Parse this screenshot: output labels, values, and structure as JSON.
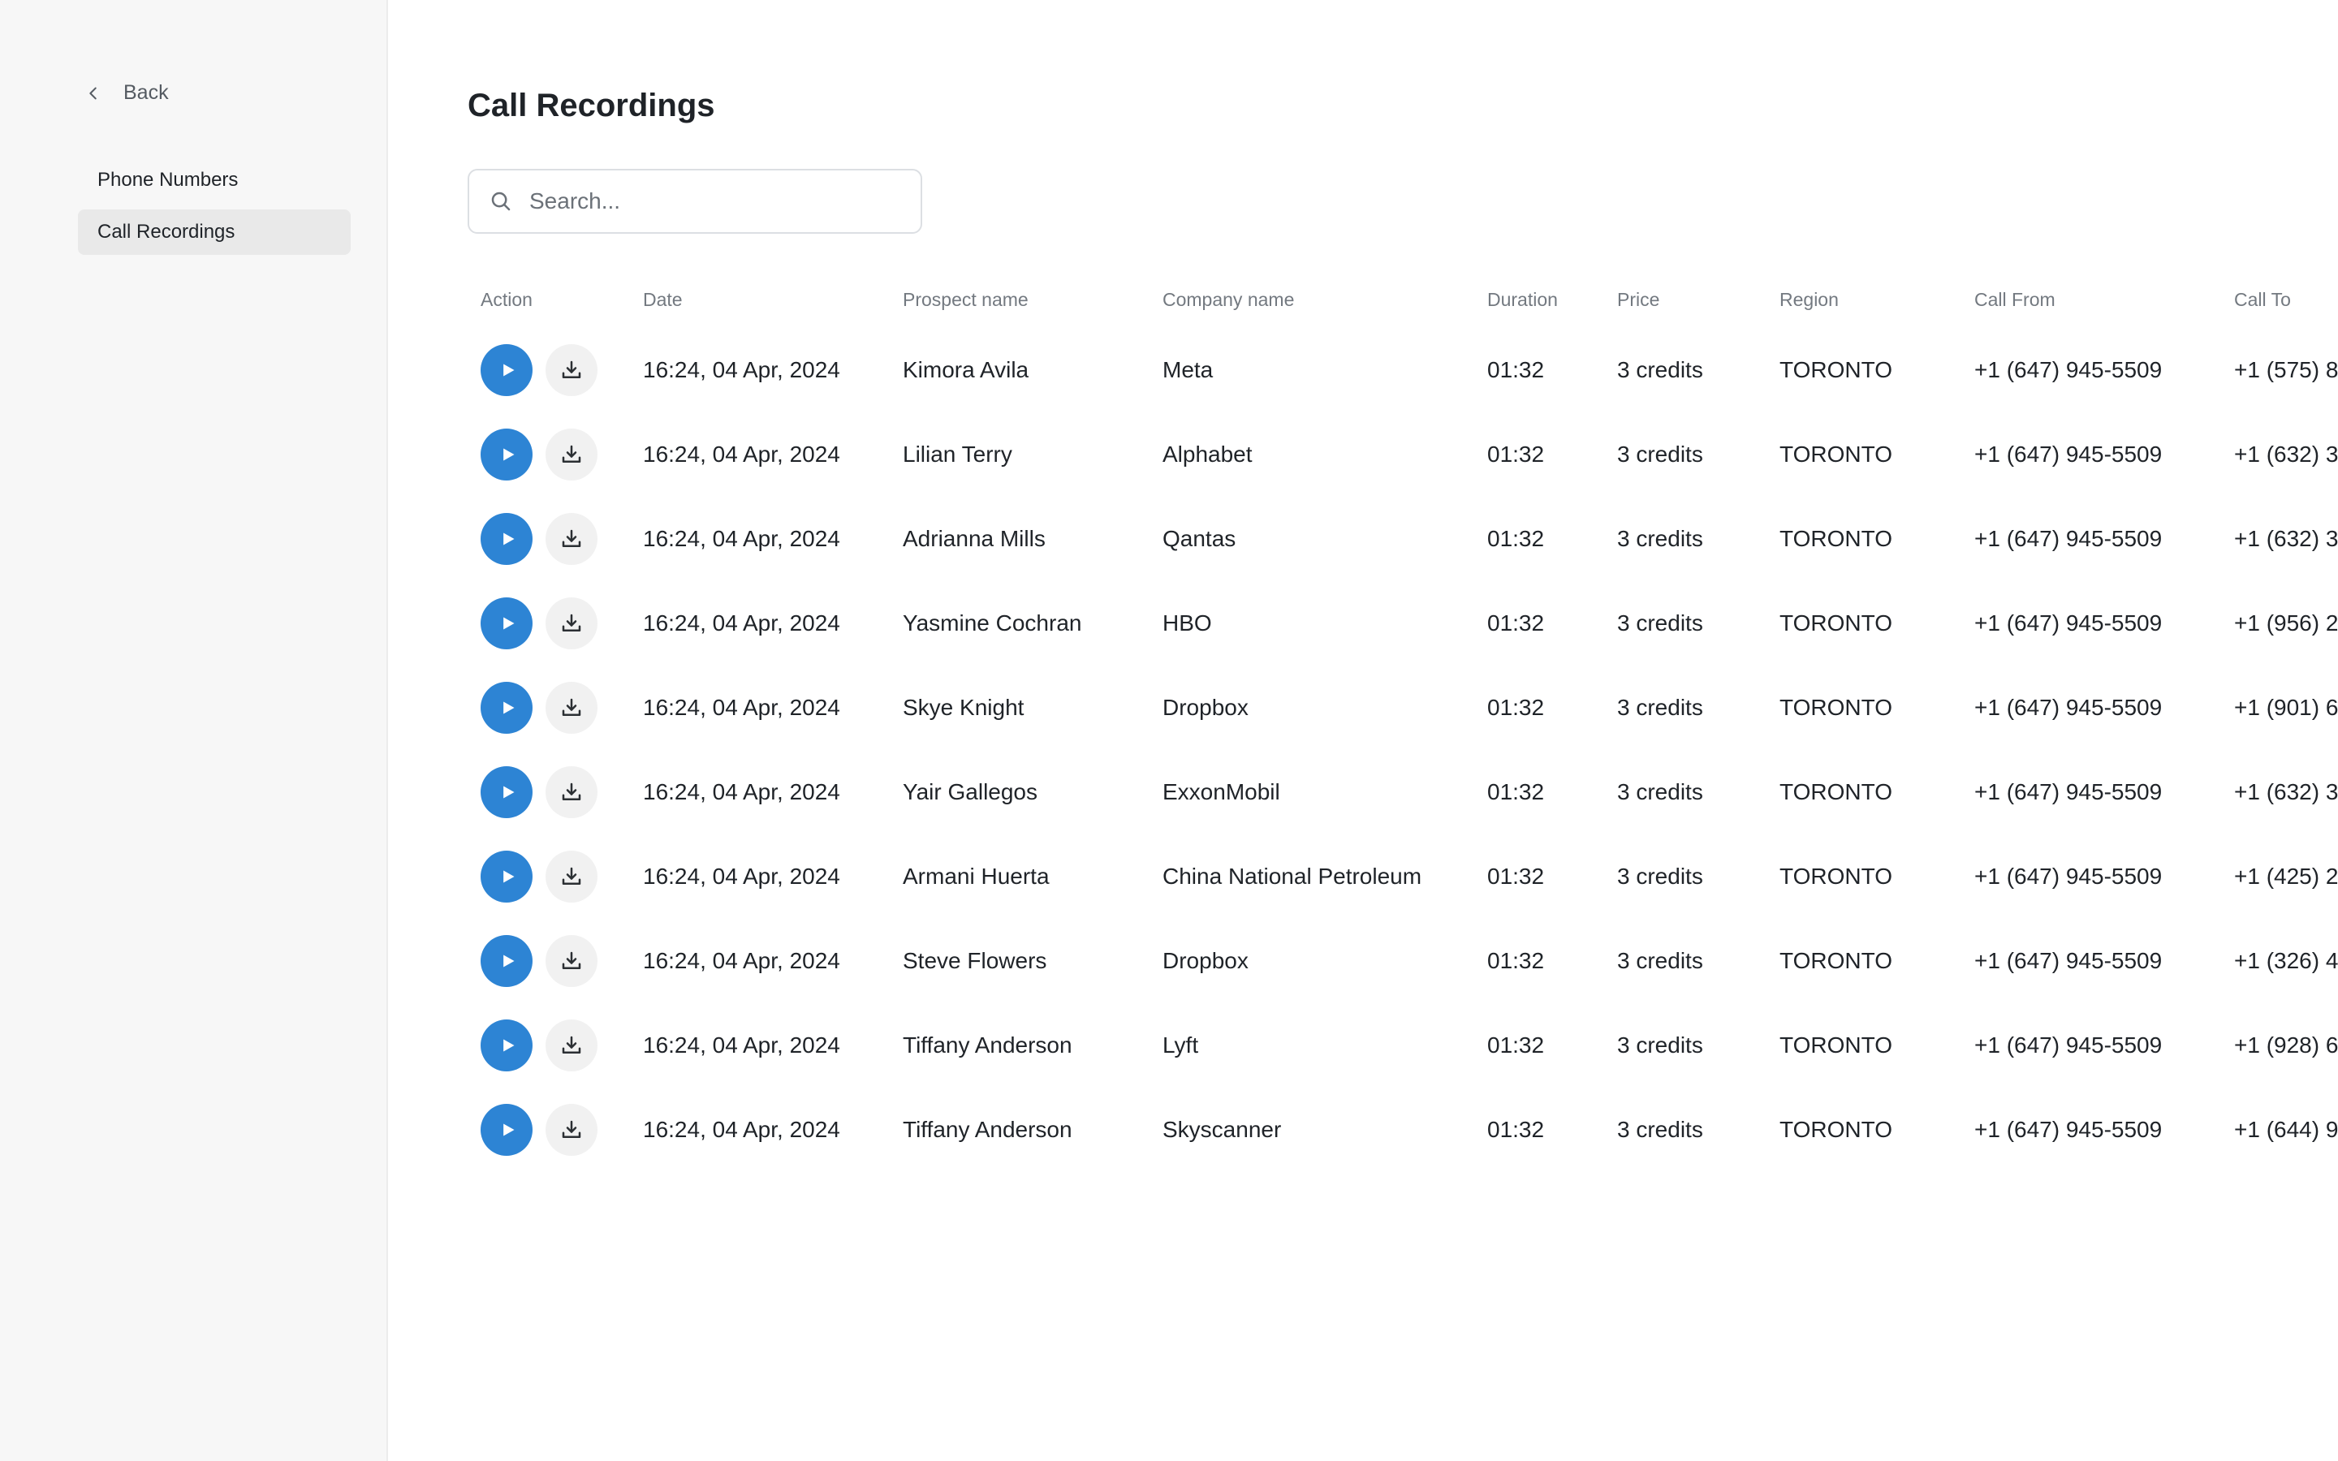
{
  "sidebar": {
    "back_label": "Back",
    "items": [
      {
        "label": "Phone Numbers",
        "active": false
      },
      {
        "label": "Call Recordings",
        "active": true
      }
    ]
  },
  "main": {
    "title": "Call Recordings",
    "search": {
      "placeholder": "Search...",
      "value": ""
    },
    "table": {
      "columns": [
        "Action",
        "Date",
        "Prospect name",
        "Company name",
        "Duration",
        "Price",
        "Region",
        "Call From",
        "Call To"
      ],
      "rows": [
        {
          "date": "16:24, 04 Apr, 2024",
          "prospect": "Kimora Avila",
          "company": "Meta",
          "duration": "01:32",
          "price": "3 credits",
          "region": "TORONTO",
          "call_from": "+1 (647) 945-5509",
          "call_to": "+1 (575) 8"
        },
        {
          "date": "16:24, 04 Apr, 2024",
          "prospect": "Lilian Terry",
          "company": "Alphabet",
          "duration": "01:32",
          "price": "3 credits",
          "region": "TORONTO",
          "call_from": "+1 (647) 945-5509",
          "call_to": "+1 (632) 3"
        },
        {
          "date": "16:24, 04 Apr, 2024",
          "prospect": "Adrianna Mills",
          "company": "Qantas",
          "duration": "01:32",
          "price": "3 credits",
          "region": "TORONTO",
          "call_from": "+1 (647) 945-5509",
          "call_to": "+1 (632) 3"
        },
        {
          "date": "16:24, 04 Apr, 2024",
          "prospect": "Yasmine Cochran",
          "company": "HBO",
          "duration": "01:32",
          "price": "3 credits",
          "region": "TORONTO",
          "call_from": "+1 (647) 945-5509",
          "call_to": "+1 (956) 2"
        },
        {
          "date": "16:24, 04 Apr, 2024",
          "prospect": "Skye Knight",
          "company": "Dropbox",
          "duration": "01:32",
          "price": "3 credits",
          "region": "TORONTO",
          "call_from": "+1 (647) 945-5509",
          "call_to": "+1 (901) 6"
        },
        {
          "date": "16:24, 04 Apr, 2024",
          "prospect": "Yair Gallegos",
          "company": "ExxonMobil",
          "duration": "01:32",
          "price": "3 credits",
          "region": "TORONTO",
          "call_from": "+1 (647) 945-5509",
          "call_to": "+1 (632) 3"
        },
        {
          "date": "16:24, 04 Apr, 2024",
          "prospect": "Armani Huerta",
          "company": "China National Petroleum",
          "duration": "01:32",
          "price": "3 credits",
          "region": "TORONTO",
          "call_from": "+1 (647) 945-5509",
          "call_to": "+1 (425) 2"
        },
        {
          "date": "16:24, 04 Apr, 2024",
          "prospect": "Steve Flowers",
          "company": "Dropbox",
          "duration": "01:32",
          "price": "3 credits",
          "region": "TORONTO",
          "call_from": "+1 (647) 945-5509",
          "call_to": "+1 (326) 4"
        },
        {
          "date": "16:24, 04 Apr, 2024",
          "prospect": "Tiffany Anderson",
          "company": "Lyft",
          "duration": "01:32",
          "price": "3 credits",
          "region": "TORONTO",
          "call_from": "+1 (647) 945-5509",
          "call_to": "+1 (928) 6"
        },
        {
          "date": "16:24, 04 Apr, 2024",
          "prospect": "Tiffany Anderson",
          "company": "Skyscanner",
          "duration": "01:32",
          "price": "3 credits",
          "region": "TORONTO",
          "call_from": "+1 (647) 945-5509",
          "call_to": "+1 (644) 9"
        }
      ]
    }
  },
  "icons": {
    "back": "chevron-left-icon",
    "search": "search-icon",
    "play": "play-icon",
    "download": "download-icon"
  },
  "colors": {
    "accent": "#2d84d4",
    "sidebar_bg": "#f7f7f7",
    "active_item_bg": "#e9e9e9",
    "download_bg": "#f1f1f1"
  }
}
